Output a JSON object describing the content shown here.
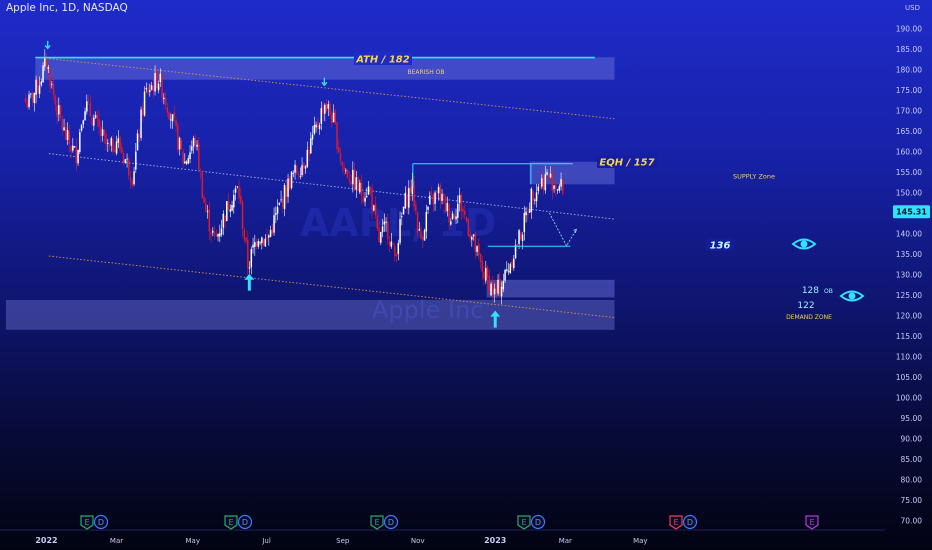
{
  "header": {
    "title": "Apple Inc, 1D, NASDAQ",
    "currency": "USD"
  },
  "watermark": {
    "ticker": "AAPL, 1D",
    "name": "Apple Inc"
  },
  "price_badge": {
    "value": "145.31",
    "color": "#26c6da"
  },
  "colors": {
    "up": "#ffffff",
    "down": "#e0192c",
    "accent": "#33e0ff",
    "label_yellow": "#f5d54a",
    "zone": "#6a72d9"
  },
  "annotations": {
    "ath": "ATH / 182",
    "bearish_ob": "BEARISH OB",
    "eqh": "EQH / 157",
    "supply_zone": "SUPPLY Zone",
    "target": "136",
    "ob": "128",
    "ob_suffix": "OB",
    "demand_value": "122",
    "demand_zone": "DEMAND ZONE"
  },
  "icons": [
    "arrow-up-icon",
    "arrow-down-icon",
    "eye-icon"
  ],
  "events": [
    {
      "letters": [
        "E",
        "D"
      ]
    },
    {
      "letters": [
        "E",
        "D"
      ]
    },
    {
      "letters": [
        "E",
        "D"
      ]
    },
    {
      "letters": [
        "E",
        "D"
      ]
    },
    {
      "letters": [
        "E",
        "D"
      ]
    },
    {
      "letters": [
        "E"
      ]
    }
  ],
  "chart_data": {
    "type": "candlestick",
    "title": "Apple Inc, 1D, NASDAQ",
    "ylabel": "USD",
    "ylim": [
      69,
      194
    ],
    "y_ticks": [
      70,
      75,
      80,
      85,
      90,
      95,
      100,
      105,
      110,
      115,
      120,
      125,
      130,
      135,
      140,
      145,
      150,
      155,
      160,
      165,
      170,
      175,
      180,
      185,
      190
    ],
    "x_ticks": [
      "2022",
      "Mar",
      "May",
      "Jul",
      "Sep",
      "Nov",
      "2023",
      "Mar",
      "May"
    ],
    "x_tick_dates": [
      "2022-01-03",
      "2022-03-01",
      "2022-05-02",
      "2022-07-01",
      "2022-09-01",
      "2022-11-01",
      "2023-01-03",
      "2023-03-01",
      "2023-05-01"
    ],
    "series": [
      {
        "type": "close_path",
        "dates": [
          "2021-12-20",
          "2021-12-27",
          "2022-01-03",
          "2022-01-10",
          "2022-01-18",
          "2022-01-27",
          "2022-02-03",
          "2022-02-10",
          "2022-02-23",
          "2022-03-01",
          "2022-03-14",
          "2022-03-24",
          "2022-04-04",
          "2022-04-13",
          "2022-04-25",
          "2022-05-04",
          "2022-05-12",
          "2022-05-20",
          "2022-06-01",
          "2022-06-08",
          "2022-06-16",
          "2022-06-24",
          "2022-07-01",
          "2022-07-12",
          "2022-07-20",
          "2022-08-01",
          "2022-08-10",
          "2022-08-17",
          "2022-08-24",
          "2022-09-01",
          "2022-09-07",
          "2022-09-16",
          "2022-09-23",
          "2022-09-30",
          "2022-10-07",
          "2022-10-13",
          "2022-10-21",
          "2022-10-27",
          "2022-11-03",
          "2022-11-10",
          "2022-11-18",
          "2022-11-28",
          "2022-12-05",
          "2022-12-14",
          "2022-12-22",
          "2023-01-03",
          "2023-01-10",
          "2023-01-19",
          "2023-01-26",
          "2023-02-02",
          "2023-02-08",
          "2023-02-14",
          "2023-02-21",
          "2023-02-27"
        ],
        "close": [
          172,
          176,
          182,
          172,
          164,
          159,
          172,
          168,
          160,
          163,
          154,
          174,
          178,
          170,
          157,
          163,
          146,
          138,
          148,
          151,
          132,
          140,
          138,
          147,
          153,
          158,
          165,
          172,
          168,
          156,
          154,
          150,
          151,
          138,
          142,
          134,
          147,
          152,
          138,
          147,
          150,
          144,
          148,
          140,
          132,
          125,
          129,
          136,
          142,
          150,
          152,
          154,
          152,
          151
        ]
      }
    ],
    "levels": [
      {
        "label": "ATH / 182",
        "value": 182.9,
        "from": "2021-12-25",
        "to": "2023-03-25"
      },
      {
        "label": "EQH / 157",
        "value": 157,
        "from": "2022-10-28",
        "to": "2023-03-07"
      },
      {
        "label": "136",
        "value": 136.9,
        "from": "2022-12-28",
        "to": "2023-03-05"
      }
    ],
    "zones": [
      {
        "label": "BEARISH OB",
        "low": 177.5,
        "high": 183,
        "from": "2021-12-25",
        "to": "2023-04-10"
      },
      {
        "label": "SUPPLY Zone",
        "low": 152,
        "high": 157.5,
        "from": "2023-01-31",
        "to": "2023-04-10"
      },
      {
        "label": "128 OB",
        "low": 124.4,
        "high": 128.7,
        "from": "2022-12-27",
        "to": "2023-04-10"
      },
      {
        "label": "DEMAND ZONE",
        "low": 116.5,
        "high": 123.8,
        "from": "2021-12-01",
        "to": "2023-04-10"
      }
    ],
    "channel_lines": [
      {
        "from": [
          "2021-12-25",
          183
        ],
        "to": [
          "2023-04-10",
          168
        ]
      },
      {
        "from": [
          "2022-01-05",
          159.5
        ],
        "to": [
          "2023-04-10",
          143.5
        ]
      },
      {
        "from": [
          "2022-01-05",
          134.5
        ],
        "to": [
          "2023-04-10",
          119.5
        ]
      }
    ],
    "markers": [
      {
        "type": "arrow-down",
        "date": "2022-01-04",
        "price": 186
      },
      {
        "type": "arrow-down",
        "date": "2022-08-17",
        "price": 177
      },
      {
        "type": "arrow-up",
        "date": "2022-06-17",
        "price": 128
      },
      {
        "type": "arrow-up",
        "date": "2023-01-03",
        "price": 119
      }
    ],
    "projection": [
      {
        "date": "2023-02-16",
        "price": 145
      },
      {
        "date": "2023-03-02",
        "price": 137
      },
      {
        "date": "2023-03-10",
        "price": 141
      }
    ]
  }
}
